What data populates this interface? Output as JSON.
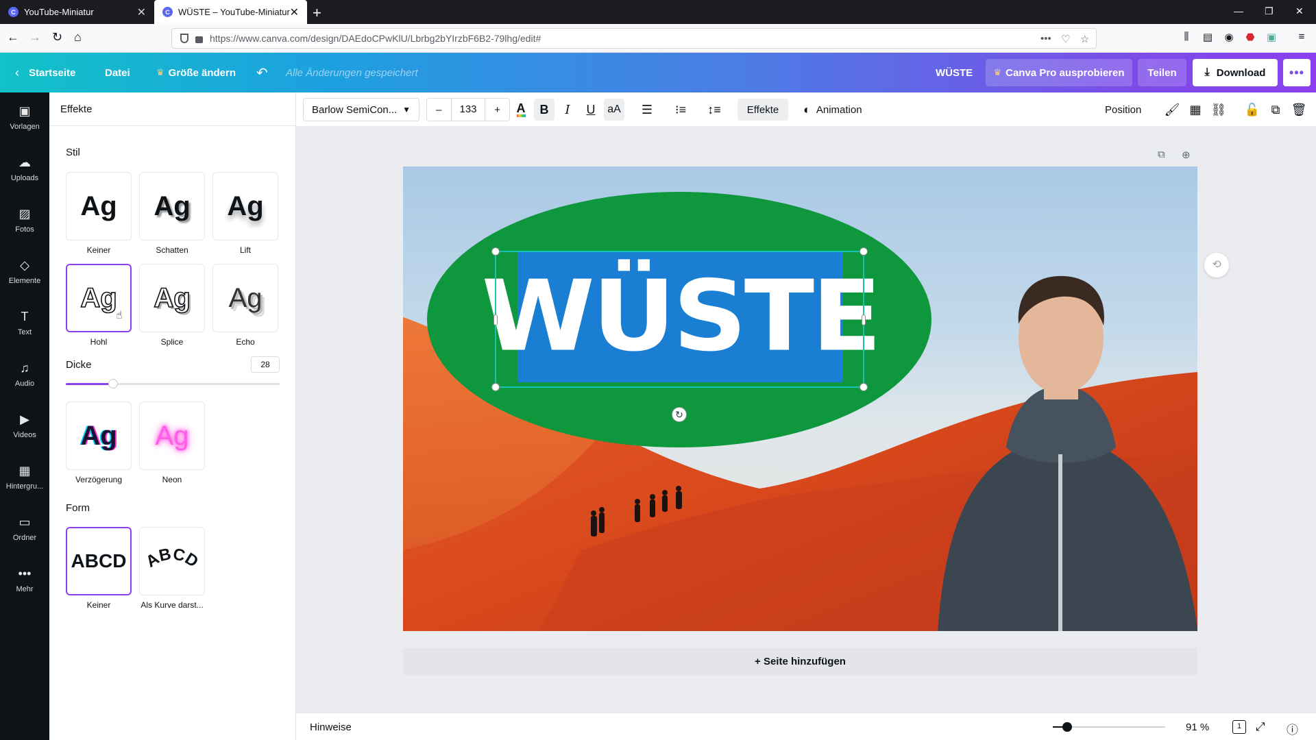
{
  "browser": {
    "tabs": [
      {
        "title": "YouTube-Miniatur",
        "active": false
      },
      {
        "title": "WÜSTE – YouTube-Miniatur",
        "active": true
      }
    ],
    "new_tab": "+",
    "url_host": "https://www.canva.com",
    "url_path": "/design/DAEdoCPwKlU/Lbrbg2bYIrzbF6B2-79lhg/edit#",
    "url_more": "•••"
  },
  "header": {
    "home": "Startseite",
    "file": "Datei",
    "resize": "Größe ändern",
    "saved_status": "Alle Änderungen gespeichert",
    "design_title": "WÜSTE",
    "pro_button": "Canva Pro ausprobieren",
    "share_button": "Teilen",
    "download_button": "Download",
    "more_button": "•••"
  },
  "rail": [
    {
      "label": "Vorlagen",
      "icon": "layout-icon",
      "glyph": "▣"
    },
    {
      "label": "Uploads",
      "icon": "upload-cloud-icon",
      "glyph": "☁"
    },
    {
      "label": "Fotos",
      "icon": "image-icon",
      "glyph": "▨"
    },
    {
      "label": "Elemente",
      "icon": "shapes-icon",
      "glyph": "◇"
    },
    {
      "label": "Text",
      "icon": "text-icon",
      "glyph": "T"
    },
    {
      "label": "Audio",
      "icon": "music-note-icon",
      "glyph": "♫"
    },
    {
      "label": "Videos",
      "icon": "video-icon",
      "glyph": "▶"
    },
    {
      "label": "Hintergru...",
      "icon": "pattern-icon",
      "glyph": "▦"
    },
    {
      "label": "Ordner",
      "icon": "folder-icon",
      "glyph": "▭"
    },
    {
      "label": "Mehr",
      "icon": "more-dots-icon",
      "glyph": "•••"
    }
  ],
  "panel": {
    "title": "Effekte",
    "style_section": "Stil",
    "style_cards": [
      {
        "label": "Keiner",
        "sample": "Ag"
      },
      {
        "label": "Schatten",
        "sample": "Ag"
      },
      {
        "label": "Lift",
        "sample": "Ag"
      },
      {
        "label": "Hohl",
        "sample": "Ag",
        "selected": true
      },
      {
        "label": "Splice",
        "sample": "Ag"
      },
      {
        "label": "Echo",
        "sample": "Ag"
      },
      {
        "label": "Verzögerung",
        "sample": "Ag"
      },
      {
        "label": "Neon",
        "sample": "Ag"
      }
    ],
    "thickness_label": "Dicke",
    "thickness_value": "28",
    "thickness_fraction": 0.22,
    "shape_section": "Form",
    "shape_cards": [
      {
        "label": "Keiner",
        "sample": "ABCD",
        "selected": true
      },
      {
        "label": "Als Kurve darst...",
        "sample": "ABCD"
      }
    ]
  },
  "toolbar": {
    "font": "Barlow SemiCon...",
    "size_minus": "–",
    "size": "133",
    "size_plus": "+",
    "bold": "B",
    "italic": "I",
    "underline": "U",
    "case": "aA",
    "effects": "Effekte",
    "animation": "Animation",
    "position": "Position"
  },
  "canvas": {
    "headline": "WÜSTE",
    "add_page": "+ Seite hinzufügen",
    "colors": {
      "oval": "#0f973e",
      "textbox": "#1a7fd3",
      "selection": "#17c3b2"
    }
  },
  "footer": {
    "hints": "Hinweise",
    "zoom": "91 %",
    "zoom_fraction": 0.13,
    "page_count": "1"
  },
  "colors": {
    "accent": "#8b3ff0",
    "rail_bg": "#0e1318"
  }
}
